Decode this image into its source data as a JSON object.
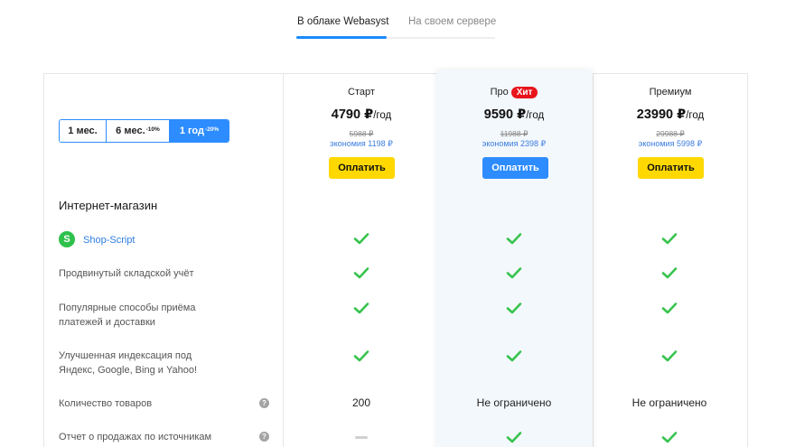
{
  "tabs": [
    {
      "label": "В облаке Webasyst",
      "active": true
    },
    {
      "label": "На своем сервере",
      "active": false
    }
  ],
  "period_selector": {
    "options": [
      {
        "label": "1 мес.",
        "badge": ""
      },
      {
        "label": "6 мес.",
        "badge": "-10%"
      },
      {
        "label": "1 год",
        "badge": "-20%"
      }
    ],
    "selected": "1 год"
  },
  "plans": [
    {
      "name": "Старт",
      "badge": "",
      "price": "4790",
      "currency": "₽",
      "period": "/год",
      "old_price": "5988 ₽",
      "savings": "экономия 1198 ₽",
      "button": "Оплатить",
      "button_color": "#ffd800"
    },
    {
      "name": "Про",
      "badge": "Хит",
      "price": "9590",
      "currency": "₽",
      "period": "/год",
      "old_price": "11988 ₽",
      "savings": "экономия 2398 ₽",
      "button": "Оплатить",
      "button_color": "#2d8cff"
    },
    {
      "name": "Премиум",
      "badge": "",
      "price": "23990",
      "currency": "₽",
      "period": "/год",
      "old_price": "29988 ₽",
      "savings": "экономия 5998 ₽",
      "button": "Оплатить",
      "button_color": "#ffd800"
    }
  ],
  "section_title": "Интернет-магазин",
  "features": [
    {
      "label": "Shop-Script",
      "icon": "shop-script-icon",
      "link": true,
      "help": false,
      "values": [
        "check",
        "check",
        "check"
      ]
    },
    {
      "label": "Продвинутый складской учёт",
      "help": false,
      "values": [
        "check",
        "check",
        "check"
      ]
    },
    {
      "label_lines": [
        "Популярные способы приёма",
        "платежей и доставки"
      ],
      "help": false,
      "values": [
        "check",
        "check",
        "check"
      ]
    },
    {
      "label_lines": [
        "Улучшенная индексация под",
        "Яндекс, Google, Bing и Yahoo!"
      ],
      "help": false,
      "values": [
        "check",
        "check",
        "check"
      ]
    },
    {
      "label": "Количество товаров",
      "help": true,
      "values": [
        "200",
        "Не ограничено",
        "Не ограничено"
      ]
    },
    {
      "label": "Отчет о продажах по источникам",
      "help": true,
      "values": [
        "dash",
        "check",
        "check"
      ]
    }
  ],
  "colors": {
    "accent": "#2d8cff",
    "check": "#37c34e",
    "hit": "#e8151b",
    "pay_yellow": "#ffd800"
  }
}
